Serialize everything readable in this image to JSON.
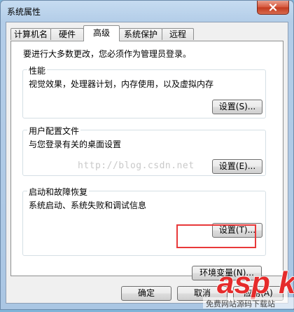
{
  "window": {
    "title": "系统属性"
  },
  "tabs": [
    {
      "label": "计算机名"
    },
    {
      "label": "硬件"
    },
    {
      "label": "高级",
      "active": true
    },
    {
      "label": "系统保护"
    },
    {
      "label": "远程"
    }
  ],
  "advanced": {
    "admin_note": "要进行大多数更改，您必须作为管理员登录。",
    "performance": {
      "title": "性能",
      "description": "视觉效果，处理器计划，内存使用，以及虚拟内存",
      "button": "设置(S)..."
    },
    "user_profiles": {
      "title": "用户配置文件",
      "description": "与您登录有关的桌面设置",
      "button": "设置(E)..."
    },
    "startup_recovery": {
      "title": "启动和故障恢复",
      "description": "系统启动、系统失败和调试信息",
      "button": "设置(T)..."
    },
    "env_button": "环境变量(N)..."
  },
  "footer": {
    "ok": "确定",
    "cancel": "取消",
    "apply": "应用(A)"
  },
  "watermark": "http://blog.csdn.net",
  "logo": {
    "brand": "asp ku",
    "tagline": "免费网站源码下载站"
  },
  "colors": {
    "highlight": "#e8393a",
    "logo_red": "#e52b2b",
    "title_bar": "#b9d1ea"
  }
}
